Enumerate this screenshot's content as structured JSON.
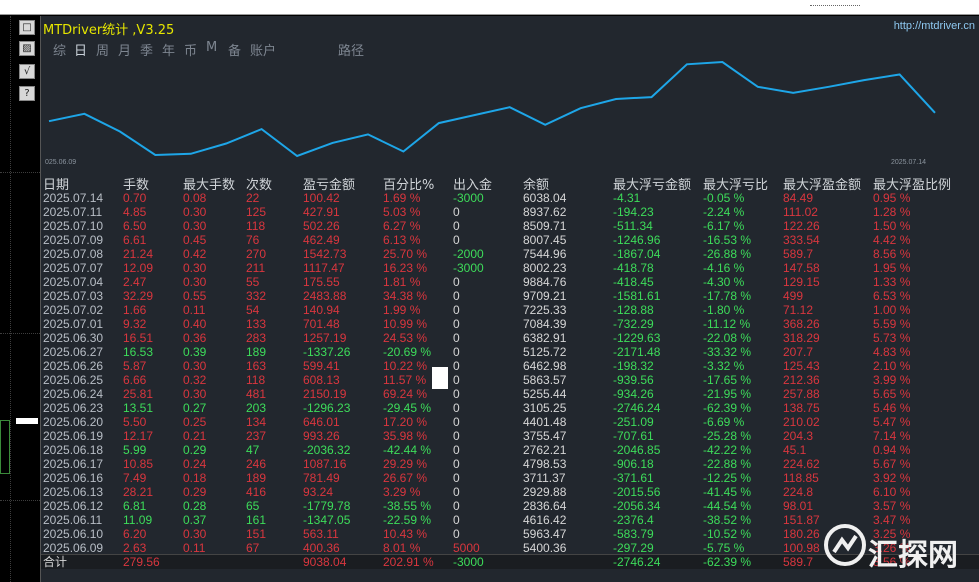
{
  "window": {
    "title": "MTDriver统计 ,V3.25",
    "url": "http://mtdriver.cn"
  },
  "side_buttons": [
    "□",
    "▨",
    "√",
    "?"
  ],
  "tabs": [
    "综",
    "日",
    "周",
    "月",
    "季",
    "年",
    "币",
    "M",
    "备",
    "账户",
    "路径"
  ],
  "active_tab": "日",
  "chart": {
    "start_label": "025.06.09",
    "end_label": "2025.07.14",
    "line_color": "#1ea6e8"
  },
  "columns": [
    "日期",
    "手数",
    "最大手数",
    "次数",
    "盈亏金额",
    "百分比%",
    "出入金",
    "余额",
    "最大浮亏金额",
    "最大浮亏比",
    "最大浮盈金额",
    "最大浮盈比例"
  ],
  "rows": [
    [
      "2025.07.14",
      "0.70",
      "0.08",
      "22",
      "100.42",
      "1.69 %",
      "-3000",
      "6038.04",
      "-4.31",
      "-0.05 %",
      "84.49",
      "0.95 %"
    ],
    [
      "2025.07.11",
      "4.85",
      "0.30",
      "125",
      "427.91",
      "5.03 %",
      "0",
      "8937.62",
      "-194.23",
      "-2.24 %",
      "111.02",
      "1.28 %"
    ],
    [
      "2025.07.10",
      "6.50",
      "0.30",
      "118",
      "502.26",
      "6.27 %",
      "0",
      "8509.71",
      "-511.34",
      "-6.17 %",
      "122.26",
      "1.50 %"
    ],
    [
      "2025.07.09",
      "6.61",
      "0.45",
      "76",
      "462.49",
      "6.13 %",
      "0",
      "8007.45",
      "-1246.96",
      "-16.53 %",
      "333.54",
      "4.42 %"
    ],
    [
      "2025.07.08",
      "21.24",
      "0.42",
      "270",
      "1542.73",
      "25.70 %",
      "-2000",
      "7544.96",
      "-1867.04",
      "-26.88 %",
      "589.7",
      "8.56 %"
    ],
    [
      "2025.07.07",
      "12.09",
      "0.30",
      "211",
      "1117.47",
      "16.23 %",
      "-3000",
      "8002.23",
      "-418.78",
      "-4.16 %",
      "147.58",
      "1.95 %"
    ],
    [
      "2025.07.04",
      "2.47",
      "0.30",
      "55",
      "175.55",
      "1.81 %",
      "0",
      "9884.76",
      "-418.45",
      "-4.30 %",
      "129.15",
      "1.33 %"
    ],
    [
      "2025.07.03",
      "32.29",
      "0.55",
      "332",
      "2483.88",
      "34.38 %",
      "0",
      "9709.21",
      "-1581.61",
      "-17.78 %",
      "499",
      "6.53 %"
    ],
    [
      "2025.07.02",
      "1.66",
      "0.11",
      "54",
      "140.94",
      "1.99 %",
      "0",
      "7225.33",
      "-128.88",
      "-1.80 %",
      "71.12",
      "1.00 %"
    ],
    [
      "2025.07.01",
      "9.32",
      "0.40",
      "133",
      "701.48",
      "10.99 %",
      "0",
      "7084.39",
      "-732.29",
      "-11.12 %",
      "368.26",
      "5.59 %"
    ],
    [
      "2025.06.30",
      "16.51",
      "0.36",
      "283",
      "1257.19",
      "24.53 %",
      "0",
      "6382.91",
      "-1229.63",
      "-22.08 %",
      "318.29",
      "5.73 %"
    ],
    [
      "2025.06.27",
      "16.53",
      "0.39",
      "189",
      "-1337.26",
      "-20.69 %",
      "0",
      "5125.72",
      "-2171.48",
      "-33.32 %",
      "207.7",
      "4.83 %"
    ],
    [
      "2025.06.26",
      "5.87",
      "0.30",
      "163",
      "599.41",
      "10.22 %",
      "0",
      "6462.98",
      "-198.32",
      "-3.32 %",
      "125.43",
      "2.10 %"
    ],
    [
      "2025.06.25",
      "6.66",
      "0.32",
      "118",
      "608.13",
      "11.57 %",
      "0",
      "5863.57",
      "-939.56",
      "-17.65 %",
      "212.36",
      "3.99 %"
    ],
    [
      "2025.06.24",
      "25.81",
      "0.30",
      "481",
      "2150.19",
      "69.24 %",
      "0",
      "5255.44",
      "-934.26",
      "-21.95 %",
      "257.88",
      "5.65 %"
    ],
    [
      "2025.06.23",
      "13.51",
      "0.27",
      "203",
      "-1296.23",
      "-29.45 %",
      "0",
      "3105.25",
      "-2746.24",
      "-62.39 %",
      "138.75",
      "5.46 %"
    ],
    [
      "2025.06.20",
      "5.50",
      "0.25",
      "134",
      "646.01",
      "17.20 %",
      "0",
      "4401.48",
      "-251.09",
      "-6.69 %",
      "210.02",
      "5.47 %"
    ],
    [
      "2025.06.19",
      "12.17",
      "0.21",
      "237",
      "993.26",
      "35.98 %",
      "0",
      "3755.47",
      "-707.61",
      "-25.28 %",
      "204.3",
      "7.14 %"
    ],
    [
      "2025.06.18",
      "5.99",
      "0.29",
      "47",
      "-2036.32",
      "-42.44 %",
      "0",
      "2762.21",
      "-2046.85",
      "-42.22 %",
      "45.1",
      "0.94 %"
    ],
    [
      "2025.06.17",
      "10.85",
      "0.24",
      "246",
      "1087.16",
      "29.29 %",
      "0",
      "4798.53",
      "-906.18",
      "-22.88 %",
      "224.62",
      "5.67 %"
    ],
    [
      "2025.06.16",
      "7.49",
      "0.18",
      "189",
      "781.49",
      "26.67 %",
      "0",
      "3711.37",
      "-371.61",
      "-12.25 %",
      "118.85",
      "3.92 %"
    ],
    [
      "2025.06.13",
      "28.21",
      "0.29",
      "416",
      "93.24",
      "3.29 %",
      "0",
      "2929.88",
      "-2015.56",
      "-41.45 %",
      "224.8",
      "6.10 %"
    ],
    [
      "2025.06.12",
      "6.81",
      "0.28",
      "65",
      "-1779.78",
      "-38.55 %",
      "0",
      "2836.64",
      "-2056.34",
      "-44.54 %",
      "98.01",
      "3.57 %"
    ],
    [
      "2025.06.11",
      "11.09",
      "0.37",
      "161",
      "-1347.05",
      "-22.59 %",
      "0",
      "4616.42",
      "-2376.4",
      "-38.52 %",
      "151.87",
      "3.47 %"
    ],
    [
      "2025.06.10",
      "6.20",
      "0.30",
      "151",
      "563.11",
      "10.43 %",
      "0",
      "5963.47",
      "-583.79",
      "-10.52 %",
      "180.26",
      "3.25 %"
    ],
    [
      "2025.06.09",
      "2.63",
      "0.11",
      "67",
      "400.36",
      "8.01 %",
      "5000",
      "5400.36",
      "-297.29",
      "-5.75 %",
      "100.98",
      "3.26 %"
    ]
  ],
  "total": [
    "合计",
    "279.56",
    "",
    "",
    "9038.04",
    "202.91 %",
    "-3000",
    "",
    "-2746.24",
    "-62.39 %",
    "589.7",
    "8.56 %"
  ],
  "watermark": "汇探网"
}
